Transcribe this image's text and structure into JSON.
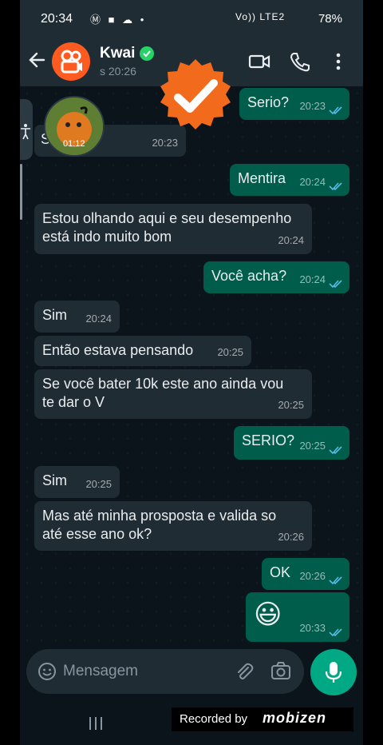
{
  "status_bar": {
    "time": "20:34",
    "left_icons": "Ⓜ ■ ☁ •",
    "signal": "Vo)) LTE2",
    "battery": "78%"
  },
  "header": {
    "contact_name": "Kwai",
    "last_seen": "s 20:26"
  },
  "thumbnail": {
    "duration": "01:12"
  },
  "messages": [
    {
      "dir": "out",
      "text": "Serio?",
      "time": "20:23"
    },
    {
      "dir": "in",
      "text": "S     ópprio",
      "time": "20:23"
    },
    {
      "dir": "out",
      "text": "Mentira",
      "time": "20:24"
    },
    {
      "dir": "in",
      "line1": "Estou olhando aqui e seu desempenho",
      "line2": "está indo muito bom",
      "time": "20:24"
    },
    {
      "dir": "out",
      "text": "Você acha?",
      "time": "20:24"
    },
    {
      "dir": "in",
      "text": "Sim",
      "time": "20:24"
    },
    {
      "dir": "in",
      "text": "Então estava pensando",
      "time": "20:25"
    },
    {
      "dir": "in",
      "line1": "Se você bater 10k este ano ainda vou",
      "line2": "te dar o V",
      "time": "20:25"
    },
    {
      "dir": "out",
      "text": "SERIO?",
      "time": "20:25"
    },
    {
      "dir": "in",
      "text": "Sim",
      "time": "20:25"
    },
    {
      "dir": "in",
      "line1": "Mas até minha prosposta e valida so",
      "line2": "até esse ano ok?",
      "time": "20:26"
    },
    {
      "dir": "out",
      "text": "OK",
      "time": "20:26"
    },
    {
      "dir": "out",
      "text": "😃",
      "time": "20:33"
    }
  ],
  "input": {
    "placeholder": "Mensagem"
  },
  "watermark": {
    "text": "Recorded by",
    "logo": "mobizen"
  },
  "colors": {
    "incoming": "#202c33",
    "outgoing": "#005c4b",
    "accent": "#00a884",
    "read_ticks": "#53bdeb",
    "badge": "#f26a1b"
  }
}
